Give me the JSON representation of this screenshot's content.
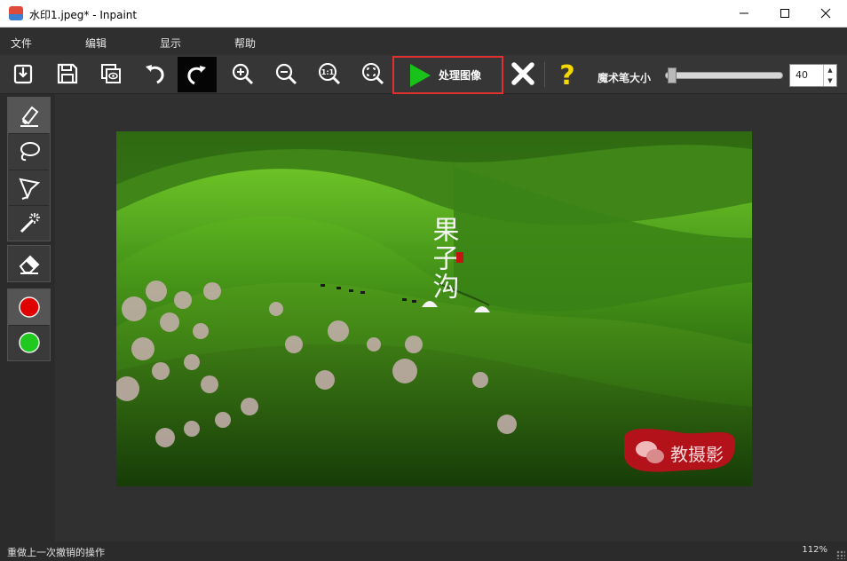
{
  "window": {
    "title": "水印1.jpeg* - Inpaint"
  },
  "menu": {
    "items": [
      "文件",
      "编辑",
      "显示",
      "帮助"
    ]
  },
  "toolbar": {
    "tools": [
      {
        "name": "open-icon",
        "tooltip": ""
      },
      {
        "name": "save-icon",
        "tooltip": ""
      },
      {
        "name": "save-as-icon",
        "tooltip": ""
      },
      {
        "name": "undo-icon",
        "tooltip": ""
      },
      {
        "name": "redo-icon",
        "tooltip": ""
      },
      {
        "name": "zoom-in-icon",
        "tooltip": ""
      },
      {
        "name": "zoom-out-icon",
        "tooltip": ""
      },
      {
        "name": "actual-size-icon",
        "tooltip": ""
      },
      {
        "name": "fit-icon",
        "tooltip": ""
      }
    ],
    "process_label": "处理图像",
    "actual_size_glyph": "1:1",
    "help_glyph": "?",
    "brush_size_label": "魔术笔大小",
    "brush_size_value": "40",
    "brush_size_fraction": 0.05,
    "colors": {
      "play": "#19c219",
      "highlight": "#e03030",
      "help": "#f5d800",
      "cancel": "#ffffff"
    }
  },
  "sidebar": {
    "tools": [
      "marker-icon",
      "lasso-icon",
      "polygon-lasso-icon",
      "magic-wand-icon",
      "eraser-icon"
    ],
    "colors": [
      {
        "name": "red",
        "hex": "#e00000"
      },
      {
        "name": "green",
        "hex": "#1fc91f"
      }
    ]
  },
  "image": {
    "calligraphy_text": "果子沟",
    "watermark_text": "教摄影",
    "watermark_color": "#b3121b"
  },
  "status": {
    "message": "重做上一次撤销的操作",
    "zoom": "112%"
  }
}
